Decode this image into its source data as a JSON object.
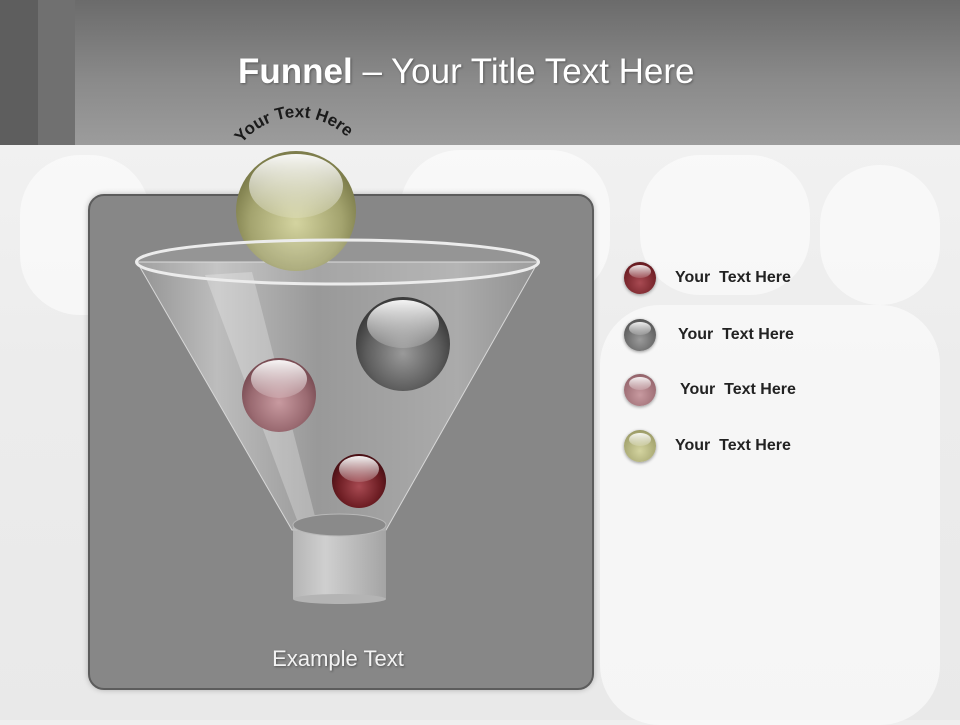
{
  "slide": {
    "title_bold": "Funnel",
    "title_rest": " – Your Title Text Here"
  },
  "funnel": {
    "top_label": "Your Text Here",
    "bottom_label": "Example Text"
  },
  "legend": [
    {
      "label": "Your  Text Here",
      "color": "#6e1e24"
    },
    {
      "label": "Your  Text Here",
      "color": "#4d4d4d"
    },
    {
      "label": "Your  Text Here",
      "color": "#8c5c63"
    },
    {
      "label": "Your  Text Here",
      "color": "#8e8a5a"
    }
  ],
  "colors": {
    "header": "#7a7a7a",
    "panel": "#878787",
    "ball_olive": "#9a9a6a",
    "ball_maroon": "#6e1e24",
    "ball_gray": "#4d4d4d",
    "ball_rose": "#8c5c63"
  }
}
